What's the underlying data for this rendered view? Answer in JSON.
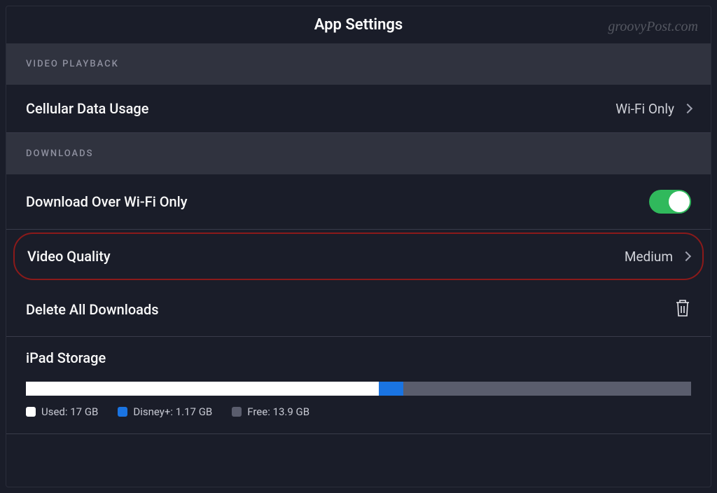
{
  "header": {
    "title": "App Settings"
  },
  "watermark": "groovyPost.com",
  "sections": {
    "video_playback": {
      "title": "VIDEO PLAYBACK",
      "cellular": {
        "label": "Cellular Data Usage",
        "value": "Wi-Fi Only"
      }
    },
    "downloads": {
      "title": "DOWNLOADS",
      "wifi_only": {
        "label": "Download Over Wi-Fi Only",
        "enabled": true
      },
      "video_quality": {
        "label": "Video Quality",
        "value": "Medium"
      },
      "delete_all": {
        "label": "Delete All Downloads"
      }
    },
    "storage": {
      "title": "iPad Storage",
      "used": {
        "label": "Used: 17 GB",
        "percent": 53
      },
      "app": {
        "label": "Disney+: 1.17 GB",
        "percent": 3.7
      },
      "free": {
        "label": "Free: 13.9 GB",
        "percent": 43.3
      }
    }
  }
}
